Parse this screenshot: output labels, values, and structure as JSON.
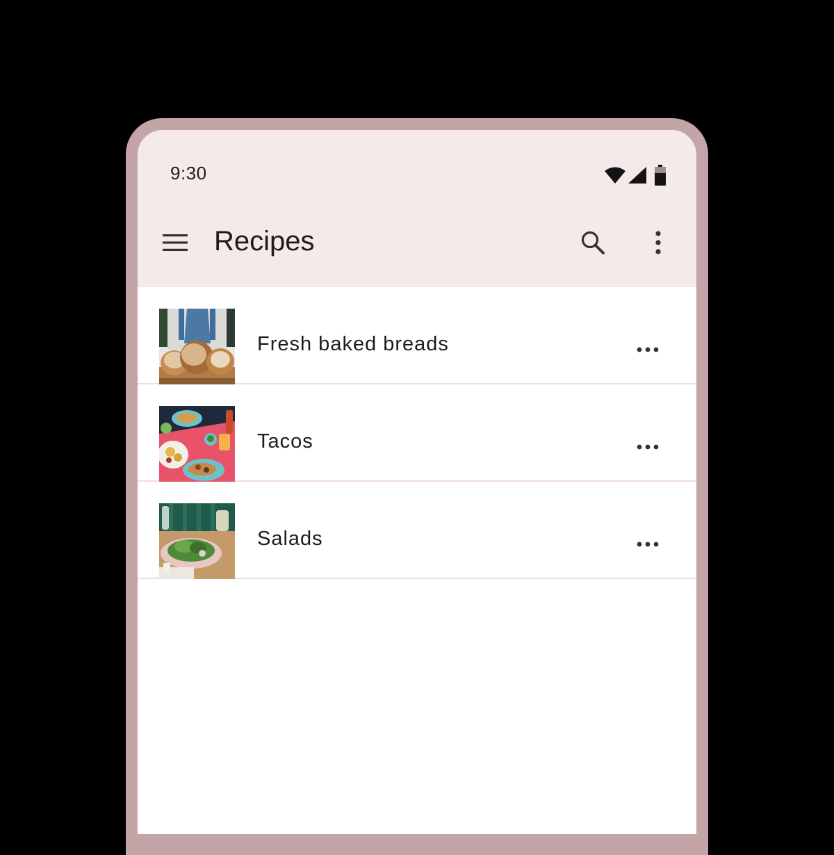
{
  "status_bar": {
    "time": "9:30",
    "icons": [
      "wifi-icon",
      "cellular-signal-icon",
      "battery-icon"
    ]
  },
  "app_bar": {
    "title": "Recipes",
    "navigation_icon": "menu-icon",
    "actions": [
      "search-icon",
      "more-vert-icon"
    ]
  },
  "recipes": [
    {
      "label": "Fresh baked breads",
      "thumbnail": "bread-photo",
      "action_icon": "more-horiz-icon"
    },
    {
      "label": "Tacos",
      "thumbnail": "tacos-photo",
      "action_icon": "more-horiz-icon"
    },
    {
      "label": "Salads",
      "thumbnail": "salad-photo",
      "action_icon": "more-horiz-icon"
    }
  ],
  "colors": {
    "device_frame": "#c4a5a7",
    "top_app_bar_background": "#f5eaea",
    "list_background": "#ffffff",
    "divider": "#f2dcdc",
    "on_surface": "#231a1b",
    "icon_color": "#3a3032"
  }
}
